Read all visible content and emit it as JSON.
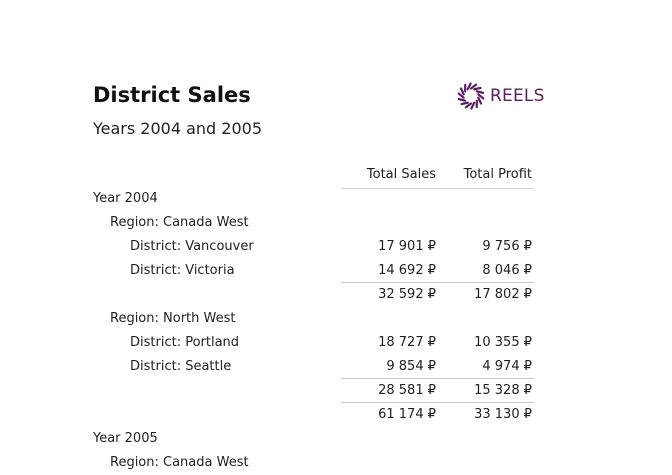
{
  "report": {
    "title": "District Sales",
    "subtitle": "Years 2004 and 2005",
    "logo_text": "REELS",
    "brand_color": "#5a1e63"
  },
  "columns": {
    "sales": "Total Sales",
    "profit": "Total Profit"
  },
  "rows": [
    {
      "level": 0,
      "label": "Year 2004",
      "sales": "",
      "profit": ""
    },
    {
      "level": 1,
      "label": "Region: Canada West",
      "sales": "",
      "profit": ""
    },
    {
      "level": 2,
      "label": "District: Vancouver",
      "sales": "17 901 ₽",
      "profit": "9 756 ₽"
    },
    {
      "level": 2,
      "label": "District: Victoria",
      "sales": "14 692 ₽",
      "profit": "8 046 ₽"
    },
    {
      "level": 3,
      "label": "",
      "sales": "32 592 ₽",
      "profit": "17 802 ₽"
    },
    {
      "level": 1,
      "label": "Region: North West",
      "sales": "",
      "profit": ""
    },
    {
      "level": 2,
      "label": "District: Portland",
      "sales": "18 727 ₽",
      "profit": "10 355 ₽"
    },
    {
      "level": 2,
      "label": "District: Seattle",
      "sales": "9 854 ₽",
      "profit": "4 974 ₽"
    },
    {
      "level": 3,
      "label": "",
      "sales": "28 581 ₽",
      "profit": "15 328 ₽"
    },
    {
      "level": 3,
      "label": "",
      "sales": "61 174 ₽",
      "profit": "33 130 ₽"
    },
    {
      "level": 0,
      "label": "Year 2005",
      "sales": "",
      "profit": ""
    },
    {
      "level": 1,
      "label": "Region: Canada West",
      "sales": "",
      "profit": ""
    }
  ]
}
